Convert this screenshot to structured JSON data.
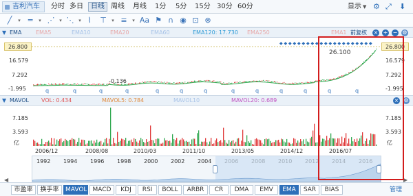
{
  "stock": {
    "name": "吉利汽车"
  },
  "periods": [
    {
      "label": "分时",
      "active": false
    },
    {
      "label": "多日",
      "active": false
    },
    {
      "label": "日线",
      "active": true
    },
    {
      "label": "周线",
      "active": false
    },
    {
      "label": "月线",
      "active": false
    },
    {
      "label": "1分",
      "active": false
    },
    {
      "label": "5分",
      "active": false
    },
    {
      "label": "15分",
      "active": false
    },
    {
      "label": "30分",
      "active": false
    },
    {
      "label": "60分",
      "active": false
    }
  ],
  "display_menu": "显示",
  "price_panel": {
    "indicator": "EMA",
    "legend": [
      {
        "label": "EMA5",
        "color": "#e8a9a9"
      },
      {
        "label": "EMA10",
        "color": "#a9c4e8"
      },
      {
        "label": "EMA20",
        "color": "#e8a9a9"
      },
      {
        "label": "EMA60",
        "color": "#a9c4e8"
      },
      {
        "label": "EMA120: 17.730",
        "color": "#2e9bd6"
      },
      {
        "label": "EMA250",
        "color": "#e8a9a9"
      },
      {
        "label": "EMA1",
        "color": "#e8a9a9"
      }
    ],
    "adjust": "前复权",
    "current_price_left": "26.800",
    "current_price_right": "26.800",
    "ticks_left": [
      "16.579",
      "7.292",
      "-1.995"
    ],
    "ticks_right": [
      "16.579",
      "7.292",
      "-1.995"
    ],
    "high_label": "26.100",
    "low_label": "-0.136",
    "dividend_marker": "q"
  },
  "volume_panel": {
    "indicator": "MAVOL",
    "legend": [
      {
        "label": "VOL: 0.434",
        "color": "#e05656"
      },
      {
        "label": "MAVOL5: 0.784",
        "color": "#e08a3c"
      },
      {
        "label": "MAVOL10",
        "color": "#a9c4e8"
      },
      {
        "label": "MAVOL20: 0.689",
        "color": "#c04fc0"
      }
    ],
    "ticks_left": [
      "7.185",
      "3.593",
      "亿"
    ],
    "ticks_right": [
      "7.185",
      "3.593",
      "亿"
    ]
  },
  "date_labels": [
    "2006/12",
    "2008/08",
    "2010/03",
    "2011/10",
    "2013/05",
    "2014/12",
    "2016/07"
  ],
  "overview_years": [
    "1992",
    "1994",
    "1996",
    "1998",
    "2000",
    "2002",
    "2004",
    "2006",
    "2008",
    "2010",
    "2012",
    "2014",
    "2016"
  ],
  "bottom_tabs": [
    {
      "label": "市盈率",
      "active": false
    },
    {
      "label": "换手率",
      "active": false
    },
    {
      "label": "MAVOL",
      "active": true
    },
    {
      "label": "MACD",
      "active": false
    },
    {
      "label": "KDJ",
      "active": false
    },
    {
      "label": "RSI",
      "active": false
    },
    {
      "label": "BOLL",
      "active": false
    },
    {
      "label": "ARBR",
      "active": false
    },
    {
      "label": "CR",
      "active": false
    },
    {
      "label": "DMA",
      "active": false
    },
    {
      "label": "EMV",
      "active": false
    },
    {
      "label": "EMA",
      "active": true
    },
    {
      "label": "SAR",
      "active": false
    },
    {
      "label": "BIAS",
      "active": false
    }
  ],
  "manage_label": "管理",
  "colors": {
    "accent": "#2d6fb9",
    "up": "#e03a3a",
    "down": "#2fa84f",
    "ema120": "#2e9bd6",
    "highlight": "#d21c1c"
  },
  "icons": [
    "draw-line-icon",
    "horizontal-line-icon",
    "trend-line-icon",
    "channel-icon",
    "vertical-line-icon",
    "fibonacci-icon",
    "text-icon",
    "magnet-icon",
    "eye-icon",
    "delete-icon",
    "settings-icon",
    "close-icon"
  ]
}
